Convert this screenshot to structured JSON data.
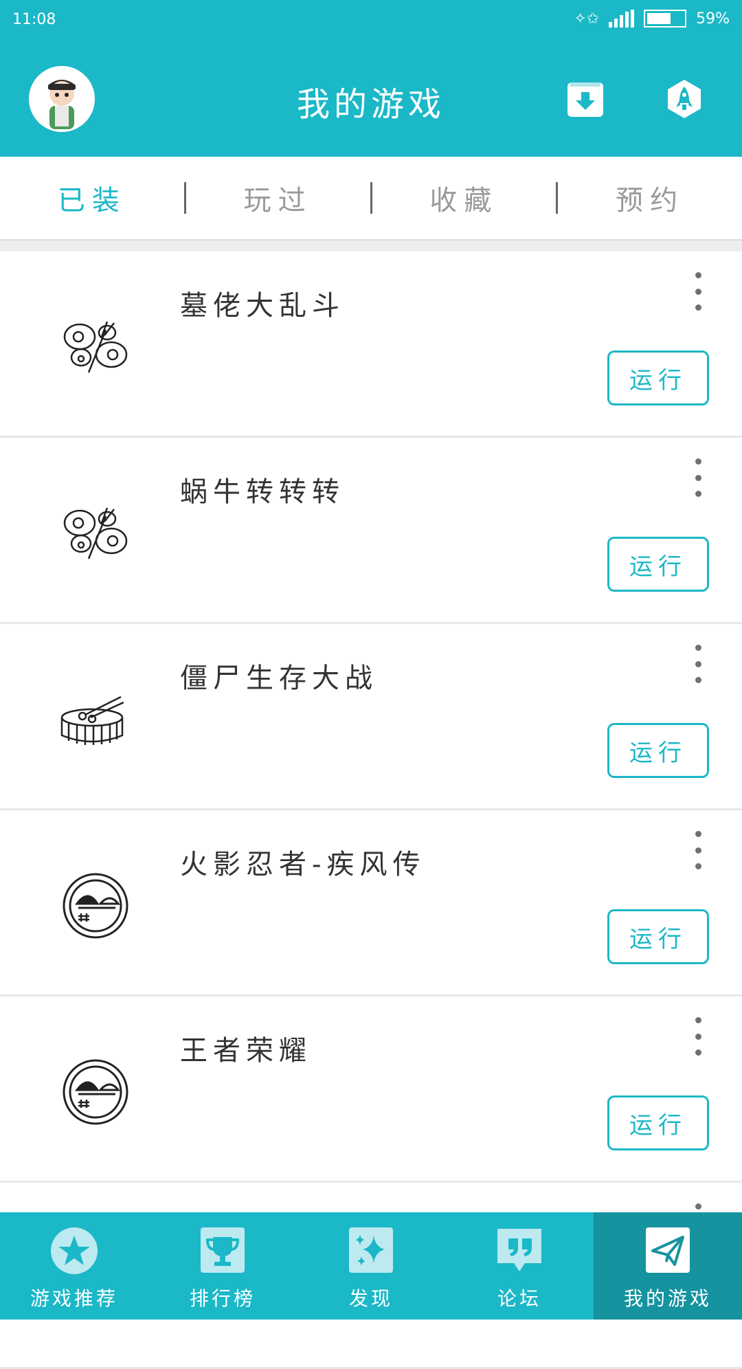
{
  "status_bar": {
    "time": "11:08",
    "battery": "59%"
  },
  "header": {
    "title": "我的游戏"
  },
  "tabs": [
    {
      "label": "已装",
      "active": true
    },
    {
      "label": "玩过",
      "active": false
    },
    {
      "label": "收藏",
      "active": false
    },
    {
      "label": "预约",
      "active": false
    }
  ],
  "games": [
    {
      "name": "墓佬大乱斗",
      "icon": "butterfly-icon",
      "run_label": "运行"
    },
    {
      "name": "蜗牛转转转",
      "icon": "butterfly-icon",
      "run_label": "运行"
    },
    {
      "name": "僵尸生存大战",
      "icon": "drum-icon",
      "run_label": "运行"
    },
    {
      "name": "火影忍者-疾风传",
      "icon": "face-badge-icon",
      "run_label": "运行"
    },
    {
      "name": "王者荣耀",
      "icon": "face-badge-icon",
      "run_label": "运行"
    }
  ],
  "bottom_nav": [
    {
      "label": "游戏推荐",
      "icon": "star-icon",
      "active": false
    },
    {
      "label": "排行榜",
      "icon": "trophy-icon",
      "active": false
    },
    {
      "label": "发现",
      "icon": "sparkle-icon",
      "active": false
    },
    {
      "label": "论坛",
      "icon": "quote-bubble-icon",
      "active": false
    },
    {
      "label": "我的游戏",
      "icon": "paper-plane-icon",
      "active": true
    }
  ],
  "colors": {
    "accent": "#1bb8c7",
    "nav_active": "#15939f",
    "text": "#333333",
    "tab_inactive": "#9a9a9a"
  }
}
